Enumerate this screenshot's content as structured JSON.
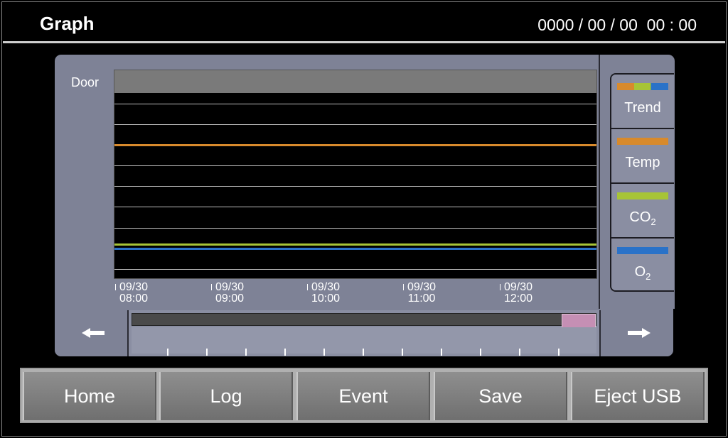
{
  "header": {
    "title": "Graph",
    "datetime": "0000 / 00 / 00  00 : 00"
  },
  "graph": {
    "door_label": "Door",
    "x_ticks": [
      {
        "date": "09/30",
        "time": "08:00"
      },
      {
        "date": "09/30",
        "time": "09:00"
      },
      {
        "date": "09/30",
        "time": "10:00"
      },
      {
        "date": "09/30",
        "time": "11:00"
      },
      {
        "date": "09/30",
        "time": "12:00"
      }
    ],
    "series_colors": {
      "temp": "#d88a2c",
      "co2": "#a7c436",
      "o2": "#2a72c8"
    }
  },
  "legend": {
    "trend": {
      "label": "Trend"
    },
    "temp": {
      "label": "Temp"
    },
    "co2": {
      "label": "CO",
      "sub": "2"
    },
    "o2": {
      "label": "O",
      "sub": "2"
    }
  },
  "navigation": {
    "left_icon": "arrow-left-icon",
    "right_icon": "arrow-right-icon",
    "scroll_position": 1.0
  },
  "bottom_nav": {
    "home": "Home",
    "log": "Log",
    "event": "Event",
    "save": "Save",
    "eject": "Eject USB"
  }
}
